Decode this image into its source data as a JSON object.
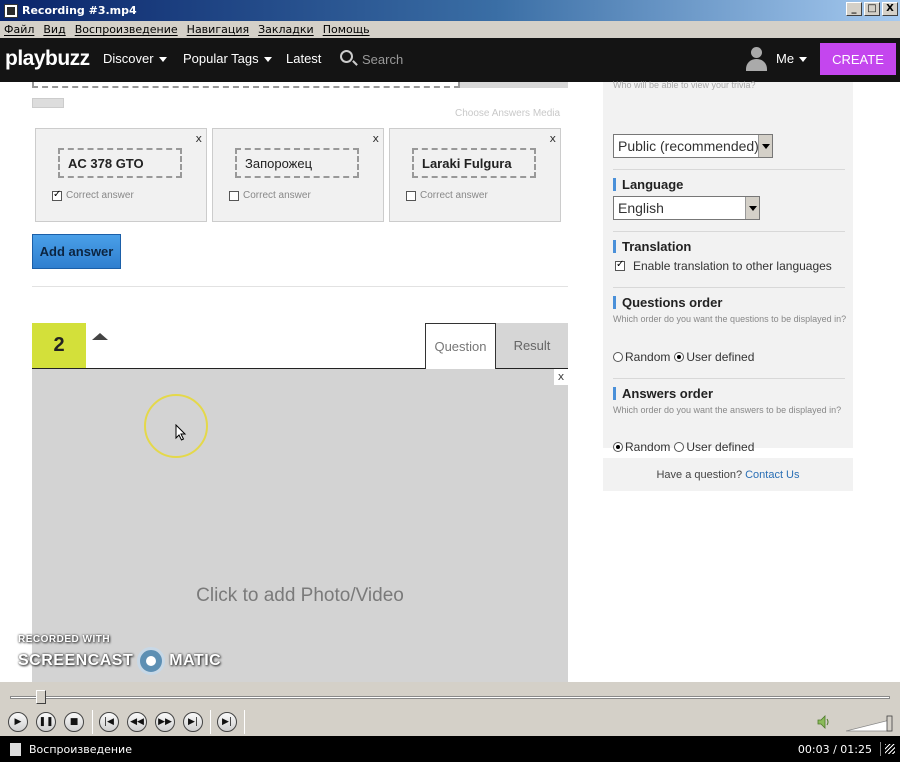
{
  "window": {
    "title": "Recording #3.mp4",
    "minimize": "_",
    "maximize": "□",
    "close": "X"
  },
  "menubar": [
    "Файл",
    "Вид",
    "Воспроизведение",
    "Навигация",
    "Закладки",
    "Помощь"
  ],
  "playbuzz": {
    "logo": "playbuzz",
    "nav": {
      "discover": "Discover",
      "popular_tags": "Popular Tags",
      "latest": "Latest",
      "search_placeholder": "Search",
      "me": "Me",
      "create": "CREATE"
    }
  },
  "editor": {
    "choose_media": "Choose Answers Media",
    "answers": [
      {
        "text": "AC 378 GTO",
        "bold": true,
        "correct": true,
        "label": "Correct answer",
        "close": "x"
      },
      {
        "text": "Запорожец",
        "bold": false,
        "correct": false,
        "label": "Correct answer",
        "close": "x"
      },
      {
        "text": "Laraki Fulgura",
        "bold": true,
        "correct": false,
        "label": "Correct answer",
        "close": "x"
      }
    ],
    "add_answer": "Add answer",
    "question": {
      "number": "2",
      "tab_question": "Question",
      "tab_result": "Result",
      "media_close": "x",
      "media_prompt": "Click to add Photo/Video"
    }
  },
  "sidebar": {
    "visibility_hint": "Who will be able to view your trivia?",
    "visibility_value": "Public (recommended)",
    "language_label": "Language",
    "language_value": "English",
    "translation_label": "Translation",
    "translation_option": "Enable translation to other languages",
    "questions_order_label": "Questions order",
    "questions_order_desc": "Which order do you want the questions to be displayed in?",
    "answers_order_label": "Answers order",
    "answers_order_desc": "Which order do you want the answers to be displayed in?",
    "random": "Random",
    "user_defined": "User defined",
    "questions_order_selected": "User defined",
    "answers_order_selected": "Random",
    "help_text": "Have a question?",
    "contact_link": "Contact Us"
  },
  "watermark": {
    "line1": "RECORDED WITH",
    "left": "SCREENCAST",
    "right": "MATIC"
  },
  "player": {
    "status": "Воспроизведение",
    "time": "00:03 / 01:25",
    "progress": 0.035
  }
}
